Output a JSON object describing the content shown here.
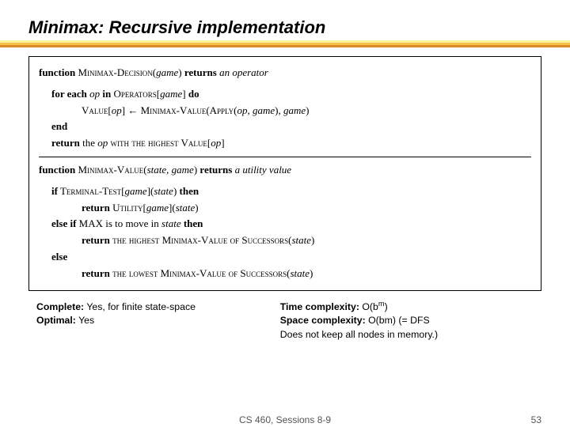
{
  "title": "Minimax: Recursive implementation",
  "algo": {
    "l1a": "function",
    "l1b": "Minimax-Decision",
    "l1c": "(",
    "l1d": "game",
    "l1e": ") ",
    "l1f": "returns",
    "l1g": " an operator",
    "l2a": "for each",
    "l2b": " op ",
    "l2c": "in",
    "l2d": " Operators",
    "l2e": "[",
    "l2f": "game",
    "l2g": "] ",
    "l2h": "do",
    "l3a": "Value",
    "l3b": "[",
    "l3c": "op",
    "l3d": "] ← Minimax-Value(Apply(",
    "l3e": "op, game",
    "l3f": "), ",
    "l3g": "game",
    "l3h": ")",
    "l4": "end",
    "l5a": "return",
    "l5b": " the ",
    "l5c": "op",
    "l5d": " with the highest Value[",
    "l5e": "op",
    "l5f": "]",
    "l6a": "function",
    "l6b": " Minimax-Value",
    "l6c": "(",
    "l6d": "state, game",
    "l6e": ") ",
    "l6f": "returns",
    "l6g": " a utility value",
    "l7a": "if",
    "l7b": " Terminal-Test",
    "l7c": "[",
    "l7d": "game",
    "l7e": "](",
    "l7f": "state",
    "l7g": ") ",
    "l7h": "then",
    "l8a": "return",
    "l8b": " Utility",
    "l8c": "[",
    "l8d": "game",
    "l8e": "](",
    "l8f": "state",
    "l8g": ")",
    "l9a": "else if",
    "l9b": " MAX is to move in ",
    "l9c": "state",
    "l9d": " ",
    "l9e": "then",
    "l10a": "return",
    "l10b": " the highest Minimax-Value of Successors(",
    "l10c": "state",
    "l10d": ")",
    "l11": "else",
    "l12a": "return",
    "l12b": " the lowest Minimax-Value of Successors(",
    "l12c": "state",
    "l12d": ")"
  },
  "bottom": {
    "complete_label": "Complete:",
    "complete_value": "  Yes, for finite state-space",
    "optimal_label": "Optimal:",
    "optimal_value": " Yes",
    "time_label": "Time complexity:",
    "time_value_a": "  O(b",
    "time_value_b": "m",
    "time_value_c": ")",
    "space_label": "Space complexity:",
    "space_value": " O(bm)   (= DFS",
    "note": "Does not keep all nodes in memory.)"
  },
  "footer": {
    "center": "CS 460,  Sessions 8-9",
    "page": "53"
  },
  "colors": {
    "bar1": "#fdf29a",
    "bar2": "#f6c24b",
    "bar3": "#d98a2a"
  }
}
